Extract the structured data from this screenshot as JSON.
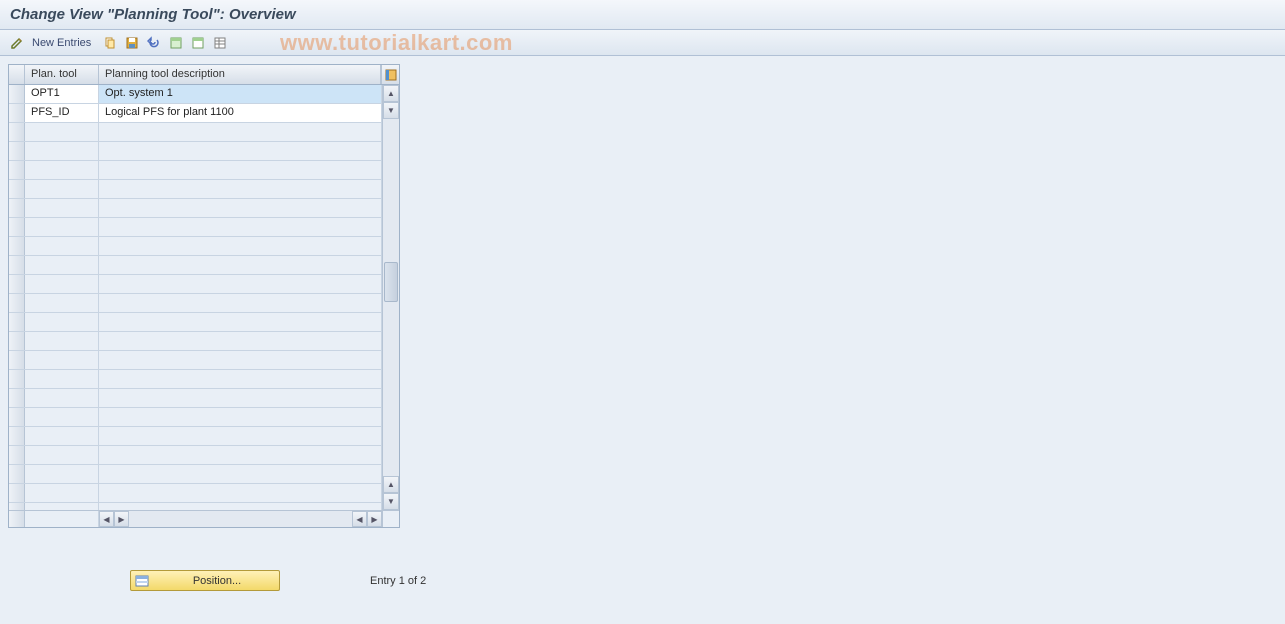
{
  "title": "Change View \"Planning Tool\": Overview",
  "watermark": "www.tutorialkart.com",
  "toolbar": {
    "new_entries_label": "New Entries"
  },
  "table": {
    "headers": {
      "plan_tool": "Plan. tool",
      "description": "Planning tool description"
    },
    "rows": [
      {
        "plan_tool": "OPT1",
        "description": "Opt. system 1",
        "highlighted": true
      },
      {
        "plan_tool": "PFS_ID",
        "description": "Logical PFS for plant 1100",
        "highlighted": false
      }
    ],
    "empty_row_count": 21
  },
  "footer": {
    "position_label": "Position...",
    "entry_text": "Entry 1 of 2"
  }
}
